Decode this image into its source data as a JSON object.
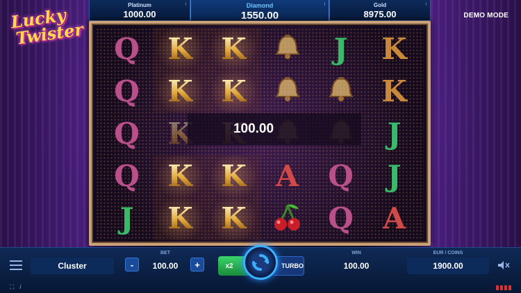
{
  "header": {
    "demo_label": "DEMO MODE"
  },
  "logo": {
    "line1": "Lucky",
    "line2": "Twister"
  },
  "jackpots": [
    {
      "name": "Platinum",
      "value": "1000.00"
    },
    {
      "name": "Diamond",
      "value": "1550.00"
    },
    {
      "name": "Gold",
      "value": "8975.00"
    }
  ],
  "reels": {
    "rows": [
      [
        "Q",
        "K",
        "K",
        "bell",
        "J",
        "K"
      ],
      [
        "Q",
        "K",
        "K",
        "bell",
        "bell",
        "K"
      ],
      [
        "Q",
        "K",
        "K",
        "bell",
        "bell",
        "J"
      ],
      [
        "Q",
        "K",
        "K",
        "A",
        "Q",
        "J"
      ],
      [
        "J",
        "K",
        "K",
        "cherry",
        "Q",
        "A"
      ]
    ],
    "win_amount": "100.00"
  },
  "controls": {
    "mode_label": "Cluster",
    "bet_label": "BET",
    "bet_value": "100.00",
    "bet_minus": "-",
    "bet_plus": "+",
    "multiplier_label": "x2",
    "turbo_label": "TURBO",
    "win_label": "WIN",
    "win_value": "100.00",
    "coins_label": "EUR / COINS",
    "coins_value": "1900.00"
  },
  "colors": {
    "frame": "#caa27a",
    "accent_blue": "#3ab0ff",
    "autoplay_green": "#2ab450"
  }
}
